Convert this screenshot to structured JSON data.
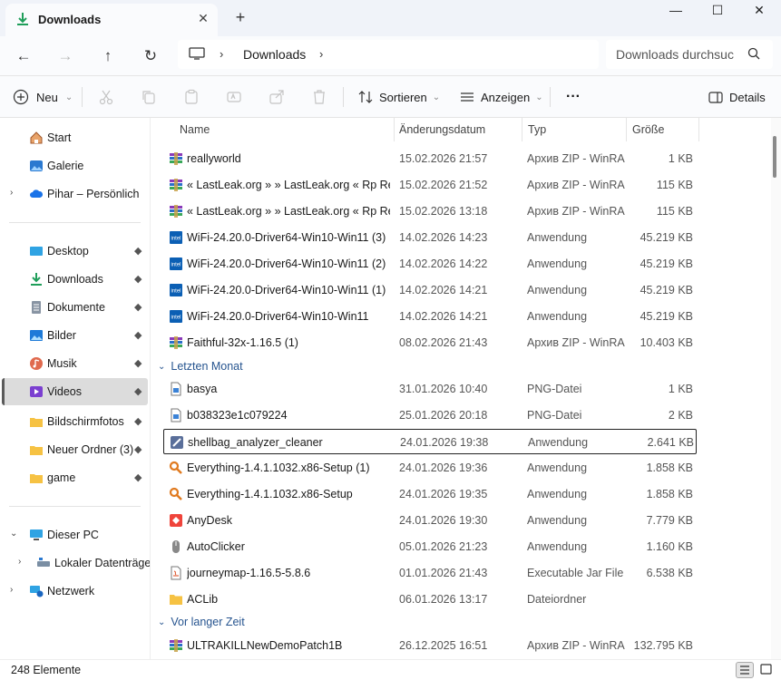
{
  "tab": {
    "title": "Downloads",
    "close": "✕",
    "new": "+"
  },
  "window": {
    "minimize": "—",
    "maximize": "☐",
    "close": "✕"
  },
  "nav": {
    "back": "←",
    "forward": "→",
    "up": "↑",
    "refresh": "↻"
  },
  "breadcrumb": {
    "current": "Downloads",
    "sep": "›"
  },
  "search": {
    "placeholder": "Downloads durchsuchen"
  },
  "toolbar": {
    "new_label": "Neu",
    "sort_label": "Sortieren",
    "view_label": "Anzeigen",
    "more_label": "···",
    "details_label": "Details",
    "chevron": "⌄"
  },
  "sidebar": {
    "items": [
      {
        "label": "Start",
        "icon": "home-icon"
      },
      {
        "label": "Galerie",
        "icon": "gallery-icon"
      },
      {
        "label": "Pihar – Persönlich",
        "icon": "cloud-icon"
      },
      {
        "label": "Desktop",
        "icon": "desktop-icon"
      },
      {
        "label": "Downloads",
        "icon": "download-icon"
      },
      {
        "label": "Dokumente",
        "icon": "documents-icon"
      },
      {
        "label": "Bilder",
        "icon": "pictures-icon"
      },
      {
        "label": "Musik",
        "icon": "music-icon"
      },
      {
        "label": "Videos",
        "icon": "videos-icon"
      },
      {
        "label": "Bildschirmfotos",
        "icon": "folder-icon"
      },
      {
        "label": "Neuer Ordner (3)",
        "icon": "folder-icon"
      },
      {
        "label": "game",
        "icon": "folder-icon"
      },
      {
        "label": "Dieser PC",
        "icon": "pc-icon"
      },
      {
        "label": "Lokaler Datenträger",
        "icon": "drive-icon"
      },
      {
        "label": "Netzwerk",
        "icon": "network-icon"
      }
    ],
    "pin": "📌",
    "expand": "›",
    "collapse": "⌄"
  },
  "columns": {
    "name": "Name",
    "date": "Änderungsdatum",
    "type": "Typ",
    "size": "Größe",
    "sort_indicator": "⌃"
  },
  "groups": {
    "last_month": "Letzten Monat",
    "long_ago": "Vor langer Zeit",
    "chev": "⌄"
  },
  "rows": [
    {
      "name": "reallyworld",
      "date": "15.02.2026 21:57",
      "type": "Архив ZIP - WinRAR",
      "size": "1 KB",
      "icon": "winrar-icon"
    },
    {
      "name": "« LastLeak.org » » LastLeak.org « Rp Real...",
      "date": "15.02.2026 21:52",
      "type": "Архив ZIP - WinRAR",
      "size": "115 KB",
      "icon": "winrar-icon"
    },
    {
      "name": "« LastLeak.org » » LastLeak.org « Rp Real...",
      "date": "15.02.2026 13:18",
      "type": "Архив ZIP - WinRAR",
      "size": "115 KB",
      "icon": "winrar-icon"
    },
    {
      "name": "WiFi-24.20.0-Driver64-Win10-Win11 (3)",
      "date": "14.02.2026 14:23",
      "type": "Anwendung",
      "size": "45.219 KB",
      "icon": "intel-icon"
    },
    {
      "name": "WiFi-24.20.0-Driver64-Win10-Win11 (2)",
      "date": "14.02.2026 14:22",
      "type": "Anwendung",
      "size": "45.219 KB",
      "icon": "intel-icon"
    },
    {
      "name": "WiFi-24.20.0-Driver64-Win10-Win11 (1)",
      "date": "14.02.2026 14:21",
      "type": "Anwendung",
      "size": "45.219 KB",
      "icon": "intel-icon"
    },
    {
      "name": "WiFi-24.20.0-Driver64-Win10-Win11",
      "date": "14.02.2026 14:21",
      "type": "Anwendung",
      "size": "45.219 KB",
      "icon": "intel-icon"
    },
    {
      "name": "Faithful-32x-1.16.5 (1)",
      "date": "08.02.2026 21:43",
      "type": "Архив ZIP - WinRAR",
      "size": "10.403 KB",
      "icon": "winrar-icon"
    },
    {
      "name": "basya",
      "date": "31.01.2026 10:40",
      "type": "PNG-Datei",
      "size": "1 KB",
      "icon": "png-file-icon"
    },
    {
      "name": "b038323e1c079224",
      "date": "25.01.2026 20:18",
      "type": "PNG-Datei",
      "size": "2 KB",
      "icon": "png-file-icon"
    },
    {
      "name": "shellbag_analyzer_cleaner",
      "date": "24.01.2026 19:38",
      "type": "Anwendung",
      "size": "2.641 KB",
      "icon": "shellbag-icon"
    },
    {
      "name": "Everything-1.4.1.1032.x86-Setup (1)",
      "date": "24.01.2026 19:36",
      "type": "Anwendung",
      "size": "1.858 KB",
      "icon": "everything-icon"
    },
    {
      "name": "Everything-1.4.1.1032.x86-Setup",
      "date": "24.01.2026 19:35",
      "type": "Anwendung",
      "size": "1.858 KB",
      "icon": "everything-icon"
    },
    {
      "name": "AnyDesk",
      "date": "24.01.2026 19:30",
      "type": "Anwendung",
      "size": "7.779 KB",
      "icon": "anydesk-icon"
    },
    {
      "name": "AutoClicker",
      "date": "05.01.2026 21:23",
      "type": "Anwendung",
      "size": "1.160 KB",
      "icon": "mouse-icon"
    },
    {
      "name": "journeymap-1.16.5-5.8.6",
      "date": "01.01.2026 21:43",
      "type": "Executable Jar File",
      "size": "6.538 KB",
      "icon": "java-icon"
    },
    {
      "name": "ACLib",
      "date": "06.01.2026 13:17",
      "type": "Dateiordner",
      "size": "",
      "icon": "folder-icon"
    },
    {
      "name": "ULTRAKILLNewDemoPatch1B",
      "date": "26.12.2025 16:51",
      "type": "Архив ZIP - WinRAR",
      "size": "132.795 KB",
      "icon": "winrar-icon"
    }
  ],
  "status": {
    "count": "248 Elemente"
  },
  "colors": {
    "accent": "#26548f",
    "selected": "#dcdcdc"
  }
}
